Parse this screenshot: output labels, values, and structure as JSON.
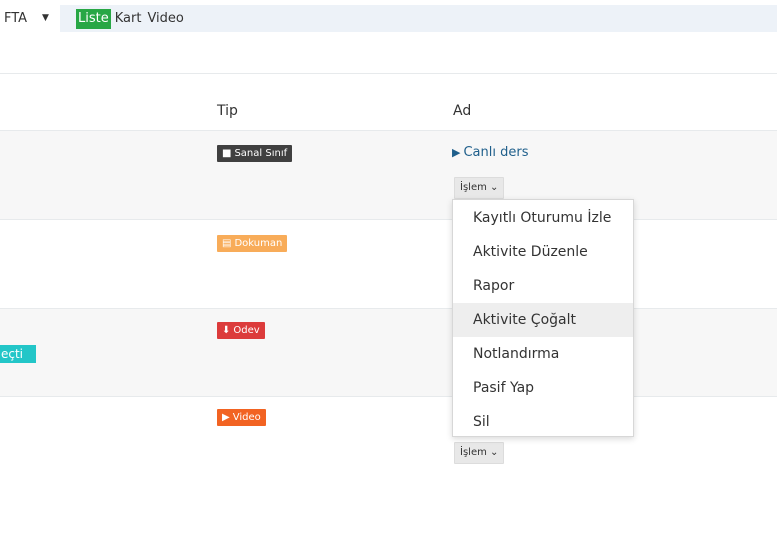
{
  "toolbar": {
    "week_label": "FTA",
    "tabs": [
      "Liste",
      "Kart",
      "Video"
    ],
    "active_tab": "Liste"
  },
  "table": {
    "headers": {
      "tip": "Tip",
      "ad": "Ad"
    },
    "rows": [
      {
        "type_label": "Sanal Sınıf",
        "name": "Canlı ders",
        "action": "İşlem"
      },
      {
        "type_label": "Dokuman"
      },
      {
        "type_label": "Odev",
        "cut_label": "eçti"
      },
      {
        "type_label": "Video",
        "action": "İşlem"
      }
    ]
  },
  "dropdown": {
    "items": [
      "Kayıtlı Oturumu İzle",
      "Aktivite Düzenle",
      "Rapor",
      "Aktivite Çoğalt",
      "Notlandırma",
      "Pasif Yap",
      "Sil"
    ],
    "hovered_item": "Aktivite Çoğalt"
  },
  "colors": {
    "active_tab": "#28a745",
    "badge_sanal": "#404040",
    "badge_dokuman": "#f8ac59",
    "badge_odev": "#dc3b3b",
    "badge_video": "#f26322",
    "link": "#1f5f8b",
    "cut_label": "#23c6c8"
  },
  "icons": {
    "sanal": "video-camera-icon",
    "dokuman": "book-icon",
    "odev": "download-icon",
    "video": "play-icon",
    "link": "play-icon",
    "caret": "caret-down-icon",
    "islem": "chevron-down-icon"
  }
}
